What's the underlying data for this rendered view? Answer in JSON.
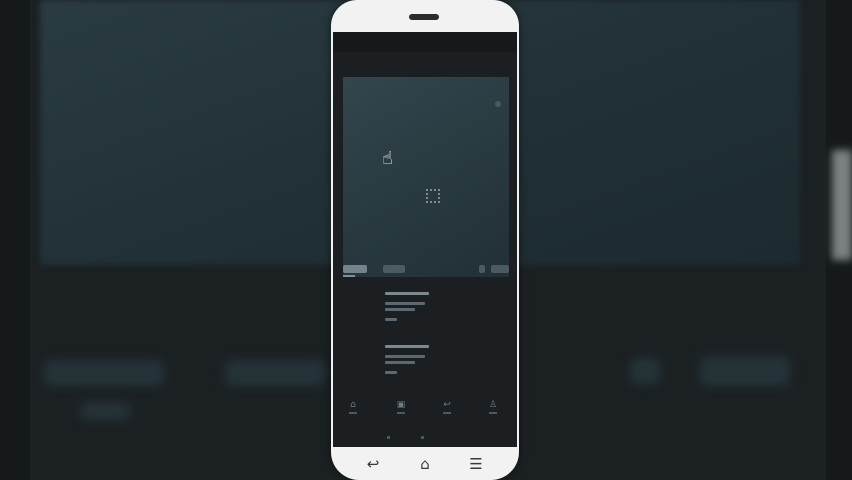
{
  "background": {
    "theme": "dark-blurred-video-player",
    "accent": "#2a3b41"
  },
  "phone": {
    "frame_color": "#f2f2f2",
    "screen_color": "#1b1f22"
  },
  "player": {
    "state": "loading",
    "loader_icon": "loading-icon",
    "cursor_icon": "hand-pointer-icon"
  },
  "tabs": [
    {
      "name": "tab-1",
      "active": true
    },
    {
      "name": "tab-2",
      "active": false
    }
  ],
  "bottom_nav": [
    {
      "icon": "home-icon",
      "glyph": "⌂"
    },
    {
      "icon": "list-icon",
      "glyph": "▣"
    },
    {
      "icon": "back-arrow-icon",
      "glyph": "↩"
    },
    {
      "icon": "profile-icon",
      "glyph": "♙"
    }
  ],
  "android_nav": [
    {
      "icon": "back-icon",
      "glyph": "↩"
    },
    {
      "icon": "home-icon",
      "glyph": "⌂"
    },
    {
      "icon": "menu-icon",
      "glyph": "☰"
    }
  ]
}
